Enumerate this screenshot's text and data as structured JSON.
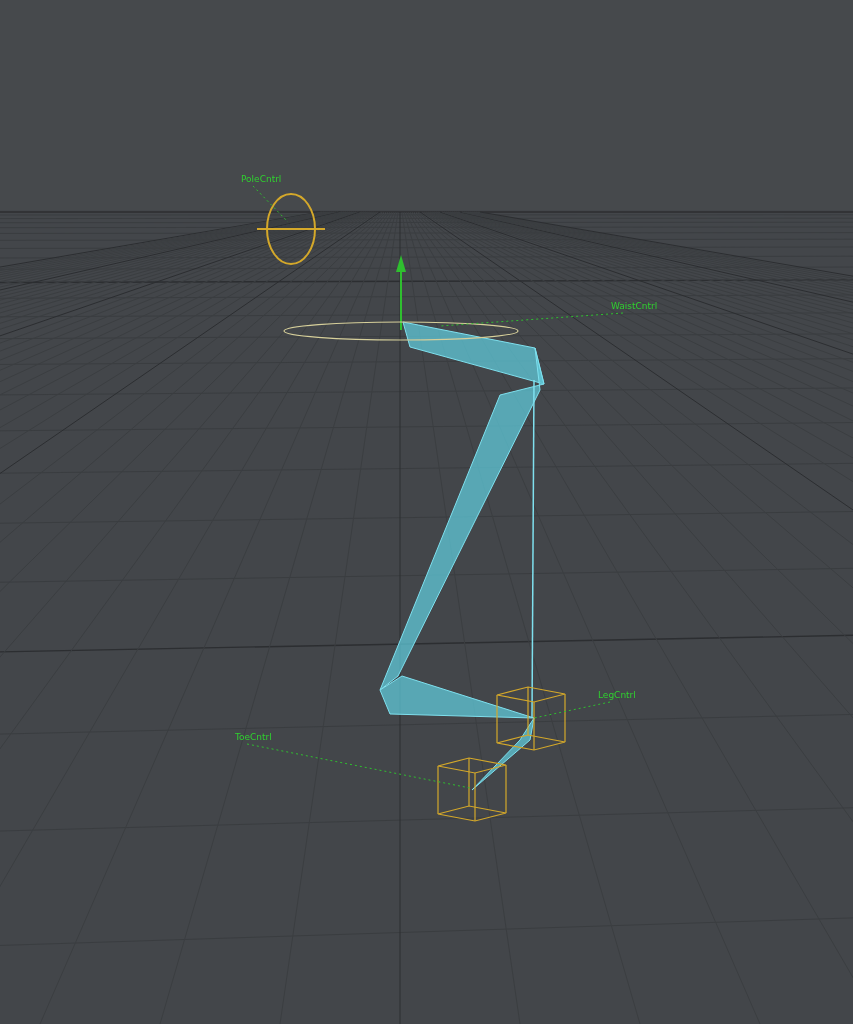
{
  "viewport": {
    "locators": [
      {
        "label": "PoleCntrl",
        "kind": "ring"
      },
      {
        "label": "WaistCntrl",
        "kind": "ellipse"
      },
      {
        "label": "LegCntrl",
        "kind": "cube"
      },
      {
        "label": "ToeCntrl",
        "kind": "cube"
      }
    ]
  }
}
